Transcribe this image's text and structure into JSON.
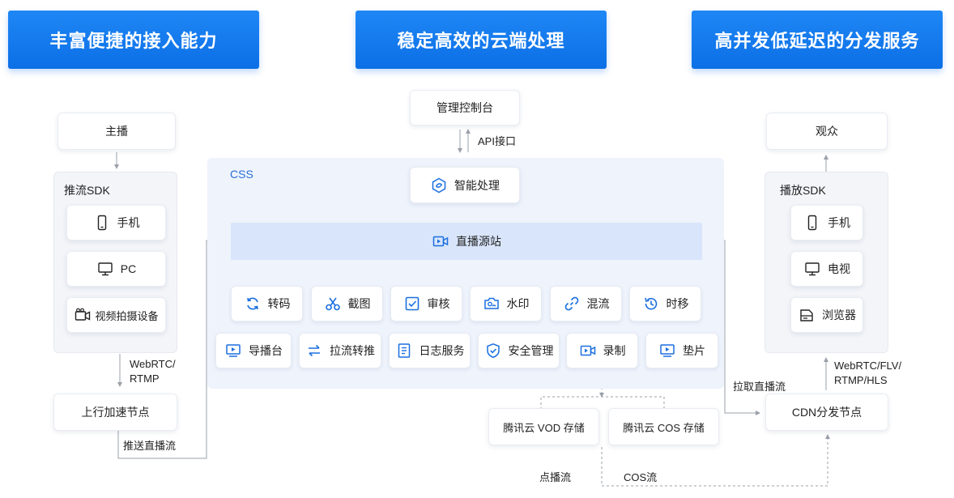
{
  "banners": {
    "left": "丰富便捷的接入能力",
    "center": "稳定高效的云端处理",
    "right": "高并发低延迟的分发服务"
  },
  "left": {
    "anchor": "主播",
    "sdk_title": "推流SDK",
    "devices": [
      "手机",
      "PC",
      "视频拍摄设备"
    ],
    "protocol_line1": "WebRTC/",
    "protocol_line2": "RTMP",
    "upload_node": "上行加速节点",
    "push_label": "推送直播流"
  },
  "center": {
    "console": "管理控制台",
    "api_label": "API接口",
    "area_title": "CSS",
    "smart": "智能处理",
    "origin": "直播源站",
    "services_row1": [
      "转码",
      "截图",
      "审核",
      "水印",
      "混流",
      "时移"
    ],
    "services_row2": [
      "导播台",
      "拉流转推",
      "日志服务",
      "安全管理",
      "录制",
      "垫片"
    ],
    "storage": [
      "腾讯云 VOD 存储",
      "腾讯云 COS 存储"
    ],
    "vod_stream": "点播流",
    "cos_stream": "COS流",
    "pull_label": "拉取直播流"
  },
  "right": {
    "audience": "观众",
    "sdk_title": "播放SDK",
    "devices": [
      "手机",
      "电视",
      "浏览器"
    ],
    "protocol_line1": "WebRTC/FLV/",
    "protocol_line2": "RTMP/HLS",
    "cdn": "CDN分发节点"
  },
  "colors": {
    "banner": "#0c6fe6",
    "icon": "#1a6fe0",
    "css_area": "#eef3fc",
    "origin_bar": "#d8e5fa",
    "line": "#9aa0aa"
  }
}
